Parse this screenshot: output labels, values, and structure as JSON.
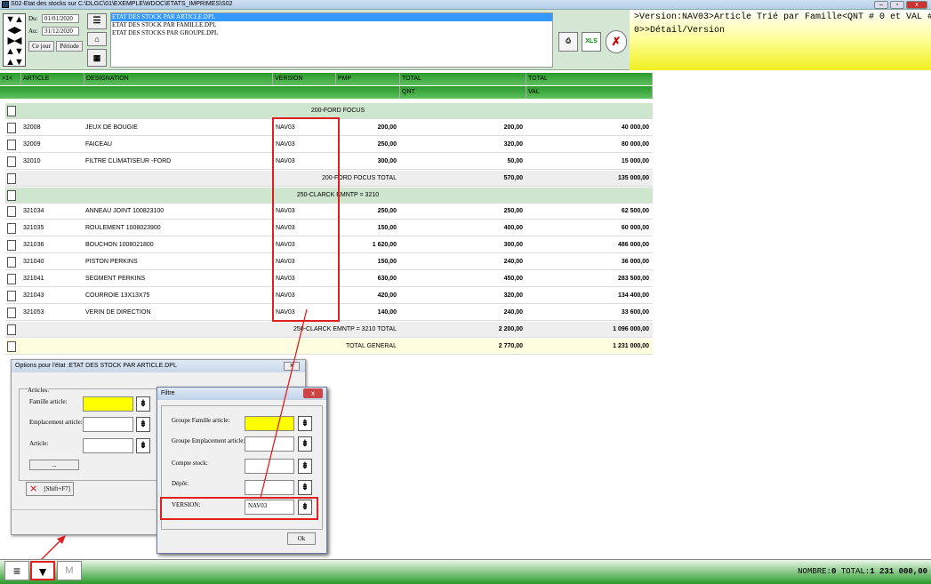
{
  "window": {
    "title": "S02-Etat des stocks sur C:\\DLGC\\01\\EXEMPLE\\WDOC\\ETATS_IMPRIMES\\S02",
    "min": "–",
    "max": "▫",
    "close": "x"
  },
  "toolbar": {
    "du_label": "Du:",
    "du_value": "01/01/2020",
    "au_label": "Au:",
    "au_value": "31/12/2020",
    "ce_jour": "Ce jour",
    "periode": "Période",
    "reports": [
      "ETAT DES STOCK PAR ARTICLE.DPL",
      "ETAT DES STOCK PAR FAMILLE.DPL",
      "ETAT DES STOCKS PAR GROUPE.DPL"
    ],
    "xls_label": "XLS"
  },
  "info": {
    "line1": ">Version:NAV03>Article Trié par Famille<QNT # 0 et VAL #",
    "line2": "0>>Détail/Version"
  },
  "grid": {
    "headers": [
      "ARTICLE",
      "DESIGNATION",
      "VERSION",
      "PMP",
      "TOTAL",
      "TOTAL"
    ],
    "subheaders": [
      "QNT",
      "VAL"
    ],
    "corner": ">1<",
    "rows": [
      {
        "type": "group",
        "label": "200-FORD FOCUS"
      },
      {
        "type": "item",
        "article": "32008",
        "designation": "JEUX DE BOUGIE",
        "version": "NAV03",
        "pmp": "200,00",
        "qnt": "200,00",
        "val": "40 000,00"
      },
      {
        "type": "item",
        "article": "32009",
        "designation": "FAICEAU",
        "version": "NAV03",
        "pmp": "250,00",
        "qnt": "320,00",
        "val": "80 000,00"
      },
      {
        "type": "item",
        "article": "32010",
        "designation": "FILTRE CLIMATISEUR -FORD",
        "version": "NAV03",
        "pmp": "300,00",
        "qnt": "50,00",
        "val": "15 000,00"
      },
      {
        "type": "total",
        "label": "200-FORD FOCUS  TOTAL",
        "qnt": "570,00",
        "val": "135 000,00"
      },
      {
        "type": "group",
        "label": "250-CLARCK EMNTP = 3210"
      },
      {
        "type": "item",
        "article": "321034",
        "designation": "ANNEAU JOINT 100823100",
        "version": "NAV03",
        "pmp": "250,00",
        "qnt": "250,00",
        "val": "62 500,00"
      },
      {
        "type": "item",
        "article": "321035",
        "designation": "ROULEMENT 1008023900",
        "version": "NAV03",
        "pmp": "150,00",
        "qnt": "400,00",
        "val": "60 000,00"
      },
      {
        "type": "item",
        "article": "321036",
        "designation": "BOUCHON 1008021800",
        "version": "NAV03",
        "pmp": "1 620,00",
        "qnt": "300,00",
        "val": "486 000,00"
      },
      {
        "type": "item",
        "article": "321040",
        "designation": "PISTON  PERKINS",
        "version": "NAV03",
        "pmp": "150,00",
        "qnt": "240,00",
        "val": "36 000,00"
      },
      {
        "type": "item",
        "article": "321041",
        "designation": "SEGMENT PERKINS",
        "version": "NAV03",
        "pmp": "630,00",
        "qnt": "450,00",
        "val": "283 500,00"
      },
      {
        "type": "item",
        "article": "321043",
        "designation": "COURROIE 13X13X75",
        "version": "NAV03",
        "pmp": "420,00",
        "qnt": "320,00",
        "val": "134 400,00"
      },
      {
        "type": "item",
        "article": "321053",
        "designation": "VERIN DE DIRECTION",
        "version": "NAV03",
        "pmp": "140,00",
        "qnt": "240,00",
        "val": "33 600,00"
      },
      {
        "type": "total",
        "label": "250-CLARCK EMNTP = 3210  TOTAL",
        "qnt": "2 200,00",
        "val": "1 096 000,00"
      },
      {
        "type": "general",
        "label": "TOTAL GENERAL",
        "qnt": "2 770,00",
        "val": "1 231 000,00"
      }
    ]
  },
  "options_dialog": {
    "title": "Options pour l'état :ETAT DES STOCK PAR ARTICLE.DPL",
    "close": "x",
    "group": "Articles:",
    "famille": "Famille article:",
    "emplacement": "Emplacement article:",
    "article": "Article:",
    "dots": "...",
    "shift_f7": "[Shift+F7]"
  },
  "filter_dialog": {
    "title": "Filtre",
    "close": "x",
    "groupe_famille": "Groupe Famille article:",
    "groupe_emplacement": "Groupe Emplacement article:",
    "compte_stock": "Compte stock:",
    "depot": "Dépôt:",
    "version_label": "VERSION:",
    "version_value": "NAV03",
    "ok": "Ok"
  },
  "status": {
    "nombre_label": "NOMBRE:",
    "nombre": "0",
    "total_label": "TOTAL:",
    "total": "1 231 000,00"
  },
  "bottom": {
    "m_label": "M"
  },
  "colors": {
    "accent_red": "#e02020",
    "green": "#2a9a2a",
    "yellow": "#ffff00",
    "selection": "#3399ff"
  }
}
